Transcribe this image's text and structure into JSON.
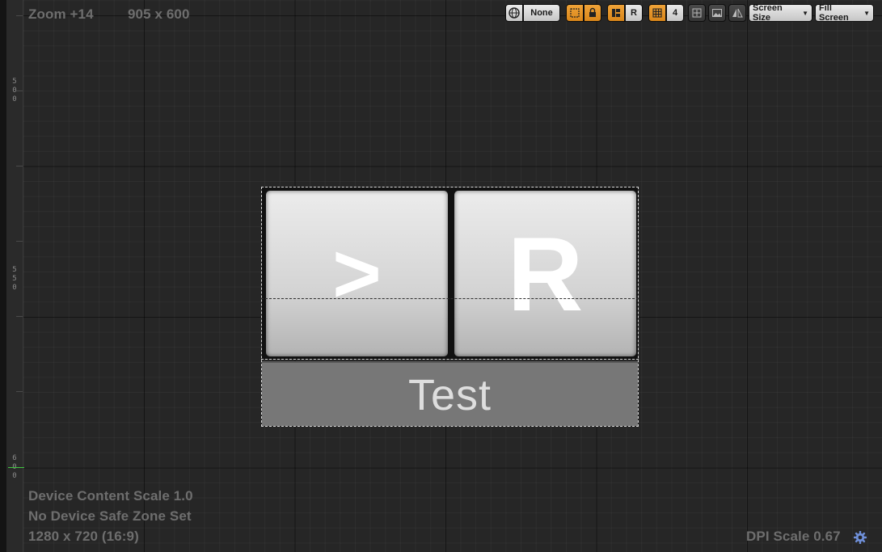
{
  "viewport": {
    "zoom_label": "Zoom +14",
    "resolution_label": "905 x 600"
  },
  "ruler": {
    "labels": [
      "5\n0\n0",
      "5\n5\n0",
      "6\n0\n0"
    ]
  },
  "toolbar": {
    "globe_icon": "globe-icon",
    "localization_value": "None",
    "outline_icon": "widget-outline-icon",
    "lock_icon": "lock-icon",
    "layout_icon": "layout-mode-icon",
    "respect_lock_label": "R",
    "grid_icon": "grid-snap-icon",
    "grid_snap_value": "4",
    "scale_icon": "scale-box-icon",
    "image_icon": "image-preview-icon",
    "flip_icon": "flip-icon",
    "screen_size_label": "Screen Size",
    "fill_screen_label": "Fill Screen"
  },
  "widget": {
    "next_button_label": ">",
    "reset_button_label": "R",
    "test_text": "Test"
  },
  "info": {
    "device_content_scale": "Device Content Scale 1.0",
    "safe_zone": "No Device Safe Zone Set",
    "device_resolution": "1280 x 720 (16:9)",
    "dpi_scale": "DPI Scale 0.67"
  },
  "colors": {
    "accent_orange": "#f0a338",
    "canvas_bg": "#262626",
    "ruler_marker_green": "#3fc43f"
  }
}
